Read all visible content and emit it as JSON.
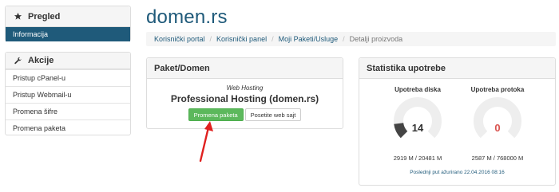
{
  "sidebar": {
    "overview": {
      "heading": "Pregled",
      "active_item": "Informacija"
    },
    "actions": {
      "heading": "Akcije",
      "items": [
        {
          "label": "Pristup cPanel-u"
        },
        {
          "label": "Pristup Webmail-u"
        },
        {
          "label": "Promena šifre"
        },
        {
          "label": "Promena paketa"
        }
      ]
    }
  },
  "page": {
    "title": "domen.rs"
  },
  "breadcrumb": {
    "items": [
      "Korisnički portal",
      "Korisnički panel",
      "Moji Paketi/Usluge"
    ],
    "current": "Detalji proizvoda",
    "separator": "/"
  },
  "package": {
    "heading": "Paket/Domen",
    "type": "Web Hosting",
    "name": "Professional Hosting (domen.rs)",
    "upgrade_button": "Promena paketa",
    "visit_button": "Posetite web sajt"
  },
  "stats": {
    "heading": "Statistika upotrebe",
    "disk": {
      "title": "Upotreba diska",
      "percent": "14",
      "percent_fraction": 0.14,
      "caption": "2919 M / 20481 M",
      "value_color": "#333333",
      "fill_color": "#444444"
    },
    "bandwidth": {
      "title": "Upotreba protoka",
      "percent": "0",
      "percent_fraction": 0,
      "caption": "2587 M / 768000 M",
      "value_color": "#d9534f",
      "fill_color": "#444444"
    },
    "updated": "Poslednji put ažurirano 22.04.2016 08:16"
  },
  "colors": {
    "brand": "#1f5a7a",
    "button_green": "#5cb85c",
    "arrow_red": "#e0201f",
    "gauge_track": "#eeeeee"
  },
  "icons": {
    "overview": "star-icon",
    "actions": "wrench-icon"
  }
}
